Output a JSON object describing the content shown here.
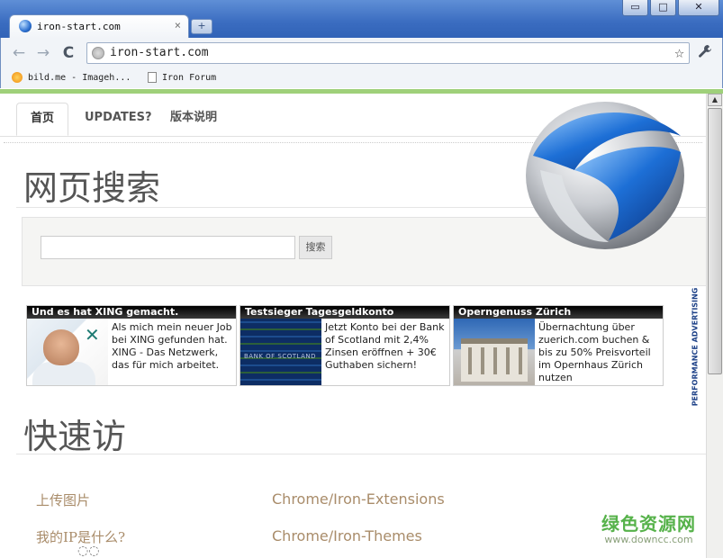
{
  "browser": {
    "tab_title": "iron-start.com",
    "tab_close": "×",
    "new_tab": "+",
    "window_buttons": [
      "▭",
      "□",
      "✕"
    ],
    "url": "iron-start.com",
    "back": "←",
    "forward": "→",
    "reload": "C",
    "star": "☆",
    "wrench": "🔧",
    "bookmarks": [
      {
        "label": "bild.me - Imageh...",
        "icon": "orange-bubble-icon"
      },
      {
        "label": "Iron Forum",
        "icon": "page-icon"
      }
    ]
  },
  "page": {
    "nav_tabs": [
      {
        "label": "首页",
        "active": true
      },
      {
        "label": "UPDATES?",
        "active": false
      },
      {
        "label": "版本说明",
        "active": false
      }
    ],
    "search_heading": "网页搜索",
    "search_input_value": "",
    "search_button": "搜索",
    "ads": [
      {
        "title": "Und es hat XING gemacht.",
        "text": "Als mich mein neuer Job bei XING gefunden hat. XING - Das Netzwerk, das für mich arbeitet."
      },
      {
        "title": "Testsieger Tagesgeldkonto",
        "text": "Jetzt Konto bei der Bank of Scotland mit 2,4% Zinsen eröffnen + 30€ Guthaben sichern!",
        "image_caption": "BANK OF SCOTLAND"
      },
      {
        "title": "Operngenuss Zürich",
        "text": "Übernachtung über zuerich.com buchen & bis zu 50% Preisvorteil im Opernhaus Zürich nutzen"
      }
    ],
    "ad_vertical_label": "PERFORMANCE ADVERTISING",
    "quick_heading": "快速访",
    "quick_links": [
      "上传图片",
      "Chrome/Iron-Extensions",
      "我的IP是什么?",
      "Chrome/Iron-Themes"
    ]
  },
  "watermark": {
    "line1": "绿色资源网",
    "line2": "www.downcc.com"
  },
  "colors": {
    "accent_green": "#9fd07a",
    "link": "#a98c6a",
    "watermark": "#56b24a"
  }
}
